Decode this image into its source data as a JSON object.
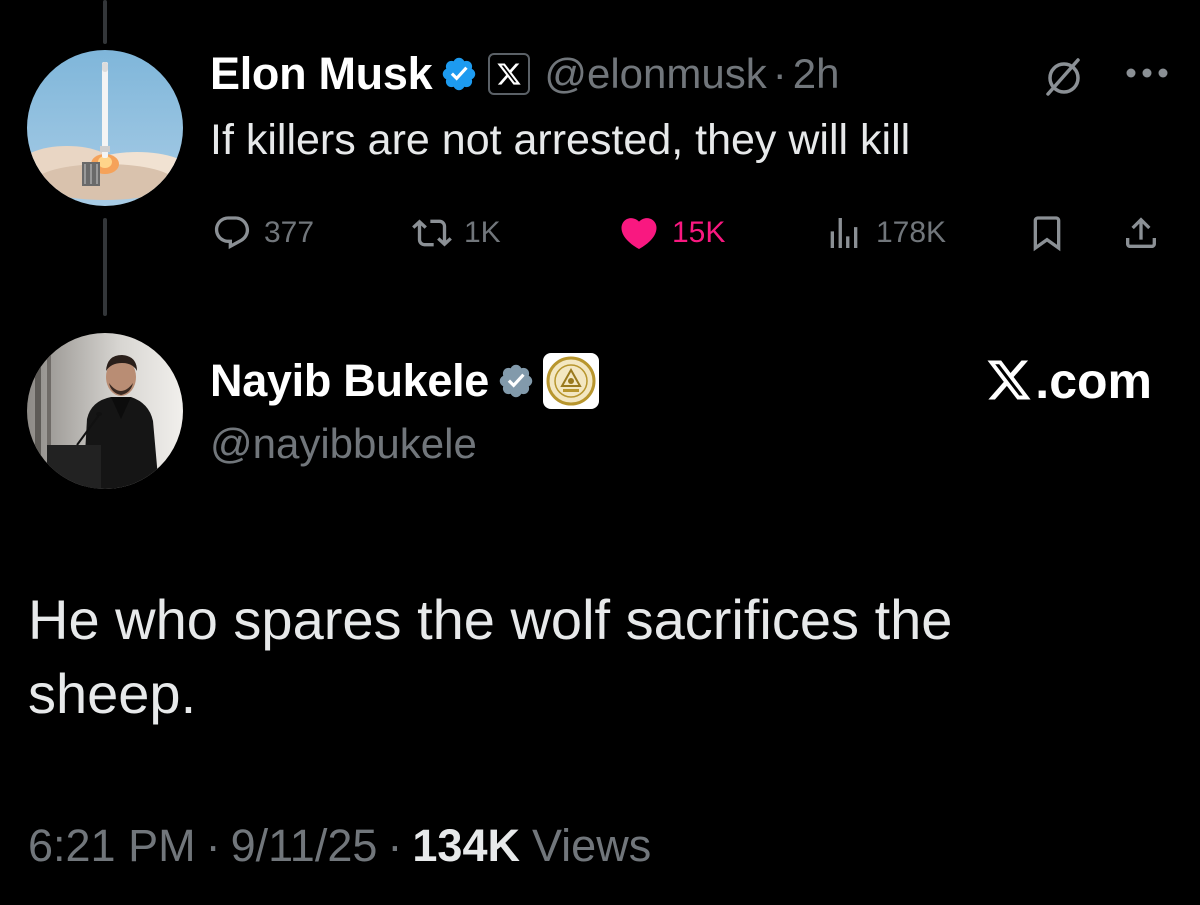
{
  "colors": {
    "background": "#000000",
    "primary_text": "#e7e9ea",
    "secondary_text": "#71767b",
    "verified_blue": "#1d9bf0",
    "like_pink": "#f91880",
    "thread_line": "#333639"
  },
  "original_post": {
    "avatar_icon": "rocket-launch-avatar",
    "author_name": "Elon Musk",
    "verified_icon": "verified-badge-icon",
    "affiliate_icon": "x-logo-icon",
    "handle": "@elonmusk",
    "separator": "·",
    "time_ago": "2h",
    "grok_icon": "grok-icon",
    "more_icon": "more-dots-icon",
    "text": "If killers are not arrested, they will kill",
    "actions": {
      "reply_count": "377",
      "repost_count": "1K",
      "like_count": "15K",
      "views_count": "178K"
    }
  },
  "reply_post": {
    "avatar_icon": "speaker-avatar",
    "author_name": "Nayib Bukele",
    "verified_icon": "verified-badge-icon",
    "affiliate_icon": "government-seal-icon",
    "handle": "@nayibbukele",
    "watermark": ".com",
    "text": "He who spares the wolf sacrifices the sheep.",
    "timestamp": "6:21 PM",
    "separator": "·",
    "date": "9/11/25",
    "views_count": "134K",
    "views_label": "Views"
  }
}
